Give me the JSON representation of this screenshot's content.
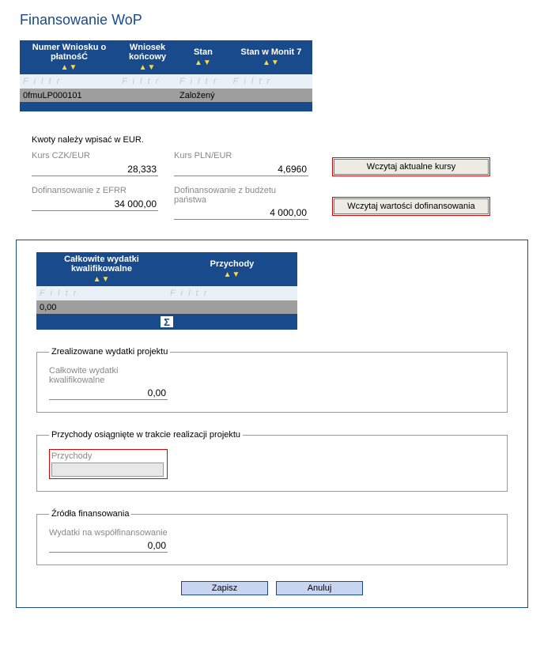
{
  "title": "Finansowanie WoP",
  "arrows": "▲▼",
  "filter_placeholder": "F i l t r",
  "grid1": {
    "headers": {
      "c0": "Numer Wniosku o płatnośĆ",
      "c1": "Wniosek końcowy",
      "c2": "Stan",
      "c3": "Stan w Monit 7"
    },
    "row": {
      "c0": "0fmuLP000101",
      "c1": "",
      "c2": "Založený",
      "c3": ""
    }
  },
  "currency_note": "Kwoty należy wpisać w EUR.",
  "rates": {
    "czk_label": "Kurs CZK/EUR",
    "czk_value": "28,333",
    "pln_label": "Kurs PLN/EUR",
    "pln_value": "4,6960",
    "efrr_label": "Dofinansowanie z EFRR",
    "efrr_value": "34 000,00",
    "budget_label": "Dofinansowanie z budżetu państwa",
    "budget_value": "4 000,00"
  },
  "buttons": {
    "load_rates": "Wczytaj aktualne kursy",
    "load_cofin": "Wczytaj wartości dofinansowania",
    "save": "Zapisz",
    "cancel": "Anuluj"
  },
  "grid2": {
    "headers": {
      "c0": "Całkowite wydatki kwalifikowalne",
      "c1": "Przychody"
    },
    "row": {
      "c0": "0,00",
      "c1": ""
    }
  },
  "fs1": {
    "legend": "Zrealizowane wydatki projektu",
    "label": "Całkowite wydatki kwalifikowalne",
    "value": "0,00"
  },
  "fs2": {
    "legend": "Przychody osiągnięte w trakcie realizacji projektu",
    "label": "Przychody"
  },
  "fs3": {
    "legend": "Źródła finansowania",
    "label": "Wydatki na współfinansowanie",
    "value": "0,00"
  },
  "sigma": "Σ"
}
